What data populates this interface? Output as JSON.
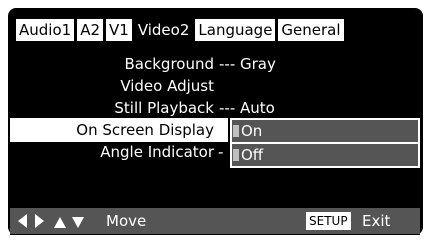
{
  "tabs": [
    "Audio1",
    "A2",
    "V1",
    "Video2",
    "Language",
    "General"
  ],
  "active_tab": "Video2",
  "menu": {
    "items": [
      {
        "label": "Background",
        "value": "--- Gray"
      },
      {
        "label": "Video Adjust",
        "value": ""
      },
      {
        "label": "Still Playback",
        "value": "--- Auto"
      },
      {
        "label": "On Screen Display",
        "value": ""
      },
      {
        "label": "Angle Indicator",
        "value": "-"
      }
    ],
    "selected_index": 3,
    "options": [
      "On",
      "Off"
    ]
  },
  "bottom": {
    "move_label": "Move",
    "setup_label": "SETUP",
    "exit_label": "Exit",
    "arrow_icons": [
      "left-arrow-icon",
      "right-arrow-icon",
      "up-arrow-icon",
      "down-arrow-icon"
    ]
  },
  "colors": {
    "background": "#000000",
    "highlight": "#ffffff",
    "bar": "#555555",
    "option_marker": "#bfbfbf"
  }
}
